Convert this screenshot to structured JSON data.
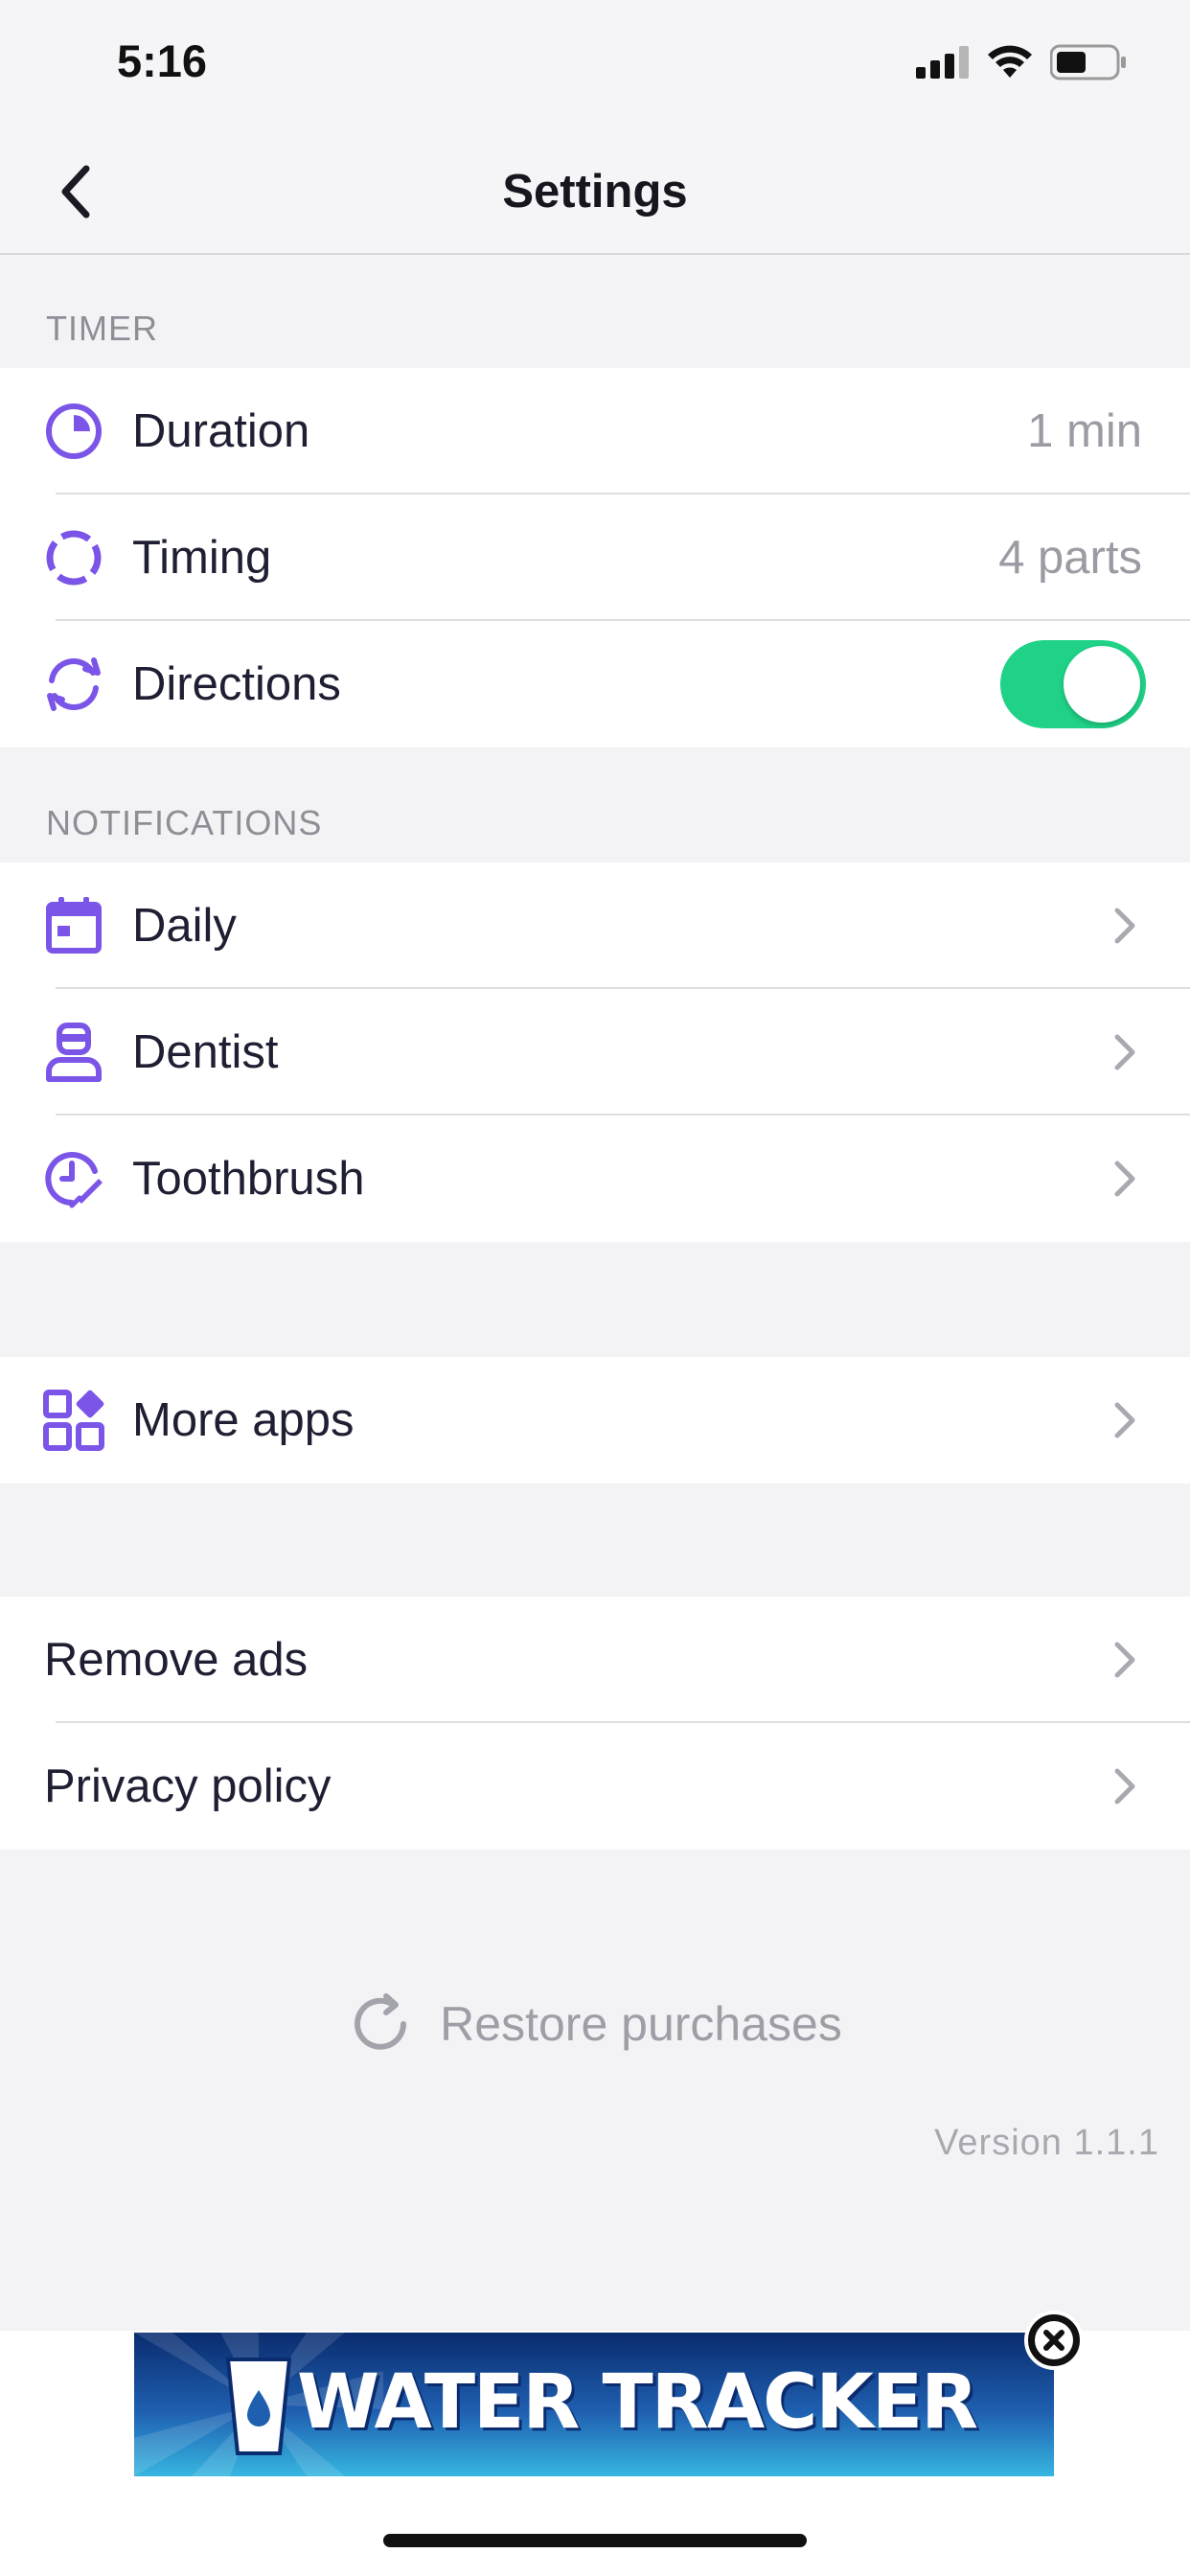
{
  "status_bar": {
    "time": "5:16"
  },
  "nav": {
    "title": "Settings"
  },
  "timer": {
    "header": "TIMER",
    "duration": {
      "label": "Duration",
      "value": "1 min",
      "icon": "pie-clock-icon"
    },
    "timing": {
      "label": "Timing",
      "value": "4 parts",
      "icon": "segmented-circle-icon"
    },
    "directions": {
      "label": "Directions",
      "enabled": true,
      "icon": "refresh-arrows-icon"
    }
  },
  "notifications": {
    "header": "NOTIFICATIONS",
    "items": [
      {
        "label": "Daily",
        "icon": "calendar-icon"
      },
      {
        "label": "Dentist",
        "icon": "dentist-icon"
      },
      {
        "label": "Toothbrush",
        "icon": "toothbrush-clock-icon"
      }
    ]
  },
  "more_apps": {
    "label": "More apps",
    "icon": "apps-grid-icon"
  },
  "misc": {
    "items": [
      {
        "label": "Remove ads"
      },
      {
        "label": "Privacy policy"
      }
    ]
  },
  "restore": {
    "label": "Restore purchases"
  },
  "version": "Version 1.1.1",
  "ad": {
    "text": "WATER TRACKER"
  },
  "colors": {
    "accent": "#7b55e8",
    "toggle_on": "#1fd287"
  }
}
